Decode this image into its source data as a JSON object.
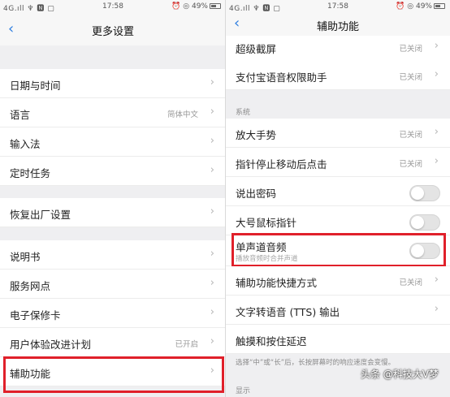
{
  "left": {
    "status": {
      "left": "4G.ıll ♆ 🅽 ▢",
      "time": "17:58",
      "right": "⏰ ◎ 49%"
    },
    "nav": {
      "title": "更多设置",
      "back_icon": "‹"
    },
    "items": [
      {
        "label": "日期与时间",
        "value": ""
      },
      {
        "label": "语言",
        "value": "简体中文"
      },
      {
        "label": "输入法",
        "value": ""
      },
      {
        "label": "定时任务",
        "value": ""
      },
      {
        "label": "恢复出厂设置",
        "value": ""
      },
      {
        "label": "说明书",
        "value": ""
      },
      {
        "label": "服务网点",
        "value": ""
      },
      {
        "label": "电子保修卡",
        "value": ""
      },
      {
        "label": "用户体验改进计划",
        "value": "已开启"
      },
      {
        "label": "辅助功能",
        "value": ""
      }
    ],
    "highlight_color": "#e0202a"
  },
  "right": {
    "status": {
      "left": "4G.ıll ♆ 🅽 ▢",
      "time": "17:58",
      "right": "⏰ ◎ 49%"
    },
    "nav": {
      "title": "辅助功能",
      "back_icon": "‹"
    },
    "items_top": [
      {
        "label": "超级截屏",
        "value": "已关闭"
      },
      {
        "label": "支付宝语音权限助手",
        "value": "已关闭"
      }
    ],
    "section_system": "系统",
    "items_system": [
      {
        "label": "放大手势",
        "value": "已关闭"
      },
      {
        "label": "指针停止移动后点击",
        "value": "已关闭"
      },
      {
        "label": "说出密码",
        "toggle": false
      },
      {
        "label": "大号鼠标指针",
        "toggle": false
      },
      {
        "label": "单声道音频",
        "sub": "播放音频时合并声道",
        "toggle": false
      },
      {
        "label": "辅助功能快捷方式",
        "value": "已关闭"
      },
      {
        "label": "文字转语音 (TTS) 输出",
        "value": ""
      },
      {
        "label": "触摸和按住延迟",
        "value": ""
      }
    ],
    "note": "选择“中”或“长”后，长按屏幕时的响应速度会变慢。",
    "section_display": "显示",
    "watermark": "头条 @科技大V梦"
  }
}
